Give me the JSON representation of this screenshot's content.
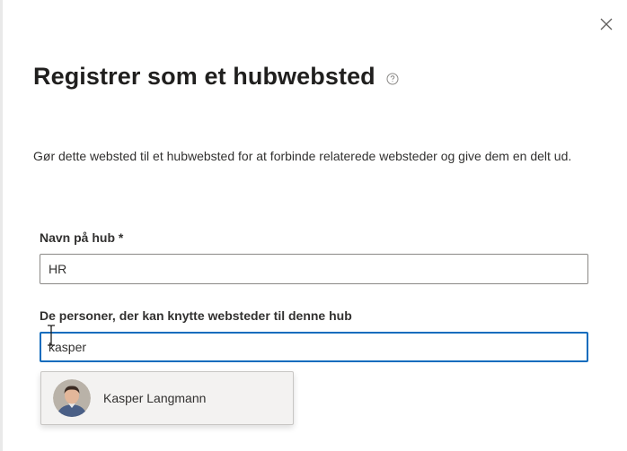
{
  "dialog": {
    "title": "Registrer som et hubwebsted",
    "description": "Gør dette websted til et hubwebsted for at forbinde relaterede websteder og give dem en delt ud.",
    "hub_name": {
      "label": "Navn på hub",
      "required_marker": "*",
      "value": "HR"
    },
    "people": {
      "label": "De personer, der kan knytte websteder til denne hub",
      "value": "kasper"
    },
    "suggestions": [
      {
        "name": "Kasper Langmann",
        "icon": "person-avatar"
      }
    ]
  },
  "icons": {
    "close": "close-icon",
    "help": "help-circle-icon",
    "cursor": "text-cursor-icon"
  },
  "colors": {
    "focus_border": "#0f6cbd",
    "field_border": "#8a8886",
    "suggestion_bg": "#f3f2f1",
    "text": "#323130"
  }
}
